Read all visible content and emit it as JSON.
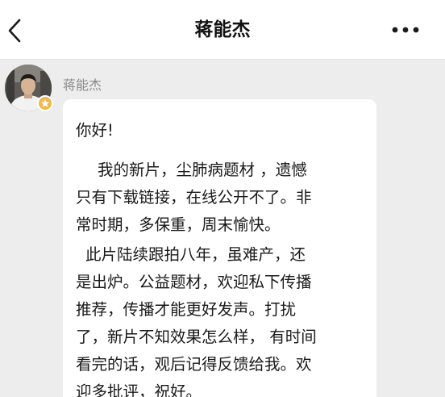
{
  "header": {
    "title": "蒋能杰"
  },
  "icons": {
    "back": "chevron-left-icon",
    "more": "ellipsis-horizontal-icon",
    "badge": "star-badge-icon"
  },
  "message": {
    "sender": "蒋能杰",
    "greeting": "你好!",
    "lines": [
      "我的新片，尘肺病题材 ，遗憾",
      "只有下载链接，在线公开不了。非",
      "常时期，多保重，周末愉快。",
      "此片陆续跟拍八年，虽难产，还",
      "是出炉。公益题材，欢迎私下传播",
      "推荐，传播才能更好发声。打扰",
      "了，新片不知效果怎么样， 有时间",
      "看完的话，观后记得反馈给我。欢",
      "迎多批评，祝好。"
    ]
  },
  "colors": {
    "background": "#ededed",
    "bubble": "#ffffff",
    "badge": "#f3b64b",
    "title": "#111111",
    "sender": "#8a8a8a"
  }
}
